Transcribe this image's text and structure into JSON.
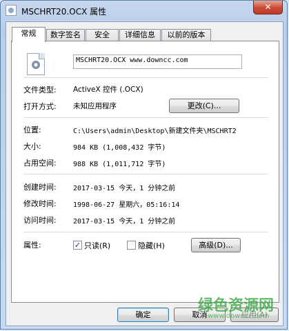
{
  "window": {
    "title": "MSCHRT20.OCX 属性",
    "close_label": "✕"
  },
  "tabs": [
    {
      "label": "常规",
      "active": true
    },
    {
      "label": "数字签名",
      "active": false
    },
    {
      "label": "安全",
      "active": false
    },
    {
      "label": "详细信息",
      "active": false
    },
    {
      "label": "以前的版本",
      "active": false
    }
  ],
  "general": {
    "file_name": "MSCHRT20.OCX www.downcc.com",
    "file_type_label": "文件类型:",
    "file_type_value": "ActiveX 控件 (.OCX)",
    "open_with_label": "打开方式:",
    "open_with_value": "未知应用程序",
    "change_button": "更改(C)...",
    "location_label": "位置:",
    "location_value": "C:\\Users\\admin\\Desktop\\新建文件夹\\MSCHRT2",
    "size_label": "大小:",
    "size_value": "984 KB (1,008,432 字节)",
    "size_on_disk_label": "占用空间:",
    "size_on_disk_value": "988 KB (1,011,712 字节)",
    "created_label": "创建时间:",
    "created_value": "2017-03-15 今天，1 分钟之前",
    "modified_label": "修改时间:",
    "modified_value": "1998-06-27 星期六，05:16:14",
    "accessed_label": "访问时间:",
    "accessed_value": "2017-03-15 今天，1 分钟之前",
    "attributes_label": "属性:",
    "readonly_label": "只读(R)",
    "readonly_checked": true,
    "readonly_mark": "✓",
    "hidden_label": "隐藏(H)",
    "hidden_checked": false,
    "advanced_button": "高级(D)..."
  },
  "footer": {
    "ok": "确定",
    "cancel": "取消",
    "apply": "应用(A)"
  },
  "watermark": {
    "text": "绿色资源网",
    "sub": "www.downcc.com"
  }
}
